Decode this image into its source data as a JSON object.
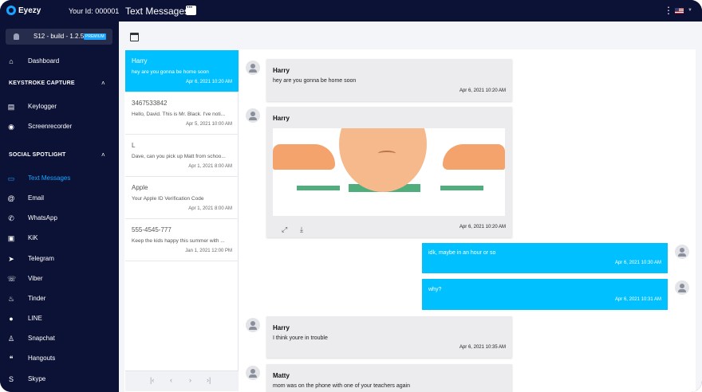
{
  "app": {
    "logo": "Eyezy",
    "user_id": "Your Id: 000001",
    "page_title": "Text Messages"
  },
  "device": {
    "name": "S12 - build - 1.2.5",
    "badge": "PREMIUM"
  },
  "nav": {
    "dashboard": "Dashboard",
    "sections": [
      {
        "title": "KEYSTROKE CAPTURE",
        "items": [
          "Keylogger",
          "Screenrecorder"
        ]
      },
      {
        "title": "SOCIAL SPOTLIGHT",
        "items": [
          "Text Messages",
          "Email",
          "WhatsApp",
          "KiK",
          "Telegram",
          "Viber",
          "Tinder",
          "LINE",
          "Snapchat",
          "Hangouts",
          "Skype"
        ]
      }
    ]
  },
  "threads": [
    {
      "name": "Harry",
      "preview": "hey are you gonna be home soon",
      "time": "Apr 6, 2021 10:20 AM",
      "active": true
    },
    {
      "name": "3467533842",
      "preview": "Hello, David. This is Mr. Black. I've noti...",
      "time": "Apr 5, 2021 10:00 AM"
    },
    {
      "name": "L",
      "preview": "Dave, can you pick up Matt from schoo...",
      "time": "Apr 1, 2021 8:00 AM"
    },
    {
      "name": "Apple",
      "preview": "Your Apple ID Verification Code",
      "time": "Apr 1, 2021 8:00 AM"
    },
    {
      "name": "555-4545-777",
      "preview": "Keep the kids happy this summer with ...",
      "time": "Jan 1, 2021 12:00 PM"
    }
  ],
  "pager": [
    "|‹",
    "‹",
    "›",
    "›|"
  ],
  "messages": [
    {
      "sender": "Harry",
      "text": "hey are you gonna be home soon",
      "time": "Apr 6, 2021 10:20 AM",
      "dir": "in"
    },
    {
      "sender": "Harry",
      "text": "",
      "time": "Apr 6, 2021 10:20 AM",
      "dir": "in",
      "media": true
    },
    {
      "sender": "",
      "text": "idk, maybe in an hour or so",
      "time": "Apr 6, 2021 10:30 AM",
      "dir": "out"
    },
    {
      "sender": "",
      "text": "why?",
      "time": "Apr 6, 2021 10:31 AM",
      "dir": "out"
    },
    {
      "sender": "Harry",
      "text": "I think youre in trouble",
      "time": "Apr 6, 2021 10:35 AM",
      "dir": "in"
    },
    {
      "sender": "Matty",
      "text": "mom was on the phone with one of your teachers again",
      "time": "",
      "dir": "in"
    }
  ],
  "colors": {
    "sidebar": "#0c1236",
    "accent": "#00c0ff",
    "link": "#1aa3ff"
  }
}
